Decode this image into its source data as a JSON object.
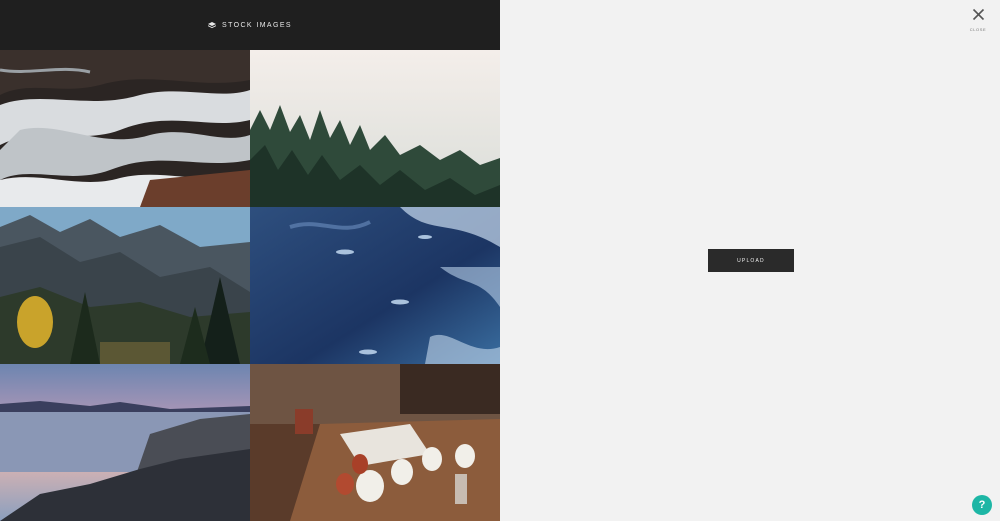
{
  "topbar": {
    "icon": "stack-icon",
    "label": "STOCK IMAGES"
  },
  "gallery": {
    "images": [
      {
        "subject": "ocean-waves-rocks"
      },
      {
        "subject": "foggy-pine-forest"
      },
      {
        "subject": "mountain-valley-hikers"
      },
      {
        "subject": "fish-in-blue-water"
      },
      {
        "subject": "sunset-lake-rocky-shore"
      },
      {
        "subject": "enamel-mugs-on-wooden-table"
      }
    ]
  },
  "panel": {
    "close_label": "CLOSE",
    "upload_label": "UPLOAD"
  },
  "help": {
    "label": "?",
    "color": "#1db6a5"
  }
}
